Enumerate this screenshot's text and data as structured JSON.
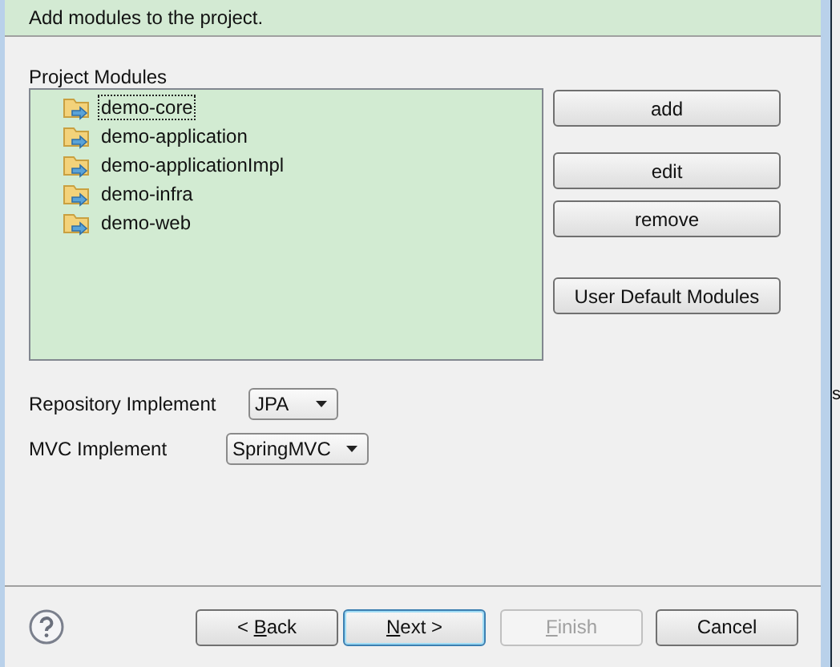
{
  "header": {
    "description": "Add modules to the project."
  },
  "modules": {
    "label": "Project Modules",
    "items": [
      {
        "name": "demo-core",
        "selected": true
      },
      {
        "name": "demo-application",
        "selected": false
      },
      {
        "name": "demo-applicationImpl",
        "selected": false
      },
      {
        "name": "demo-infra",
        "selected": false
      },
      {
        "name": "demo-web",
        "selected": false
      }
    ]
  },
  "module_buttons": [
    "add",
    "edit",
    "remove",
    "User Default Modules"
  ],
  "settings": [
    {
      "label": "Repository Implement",
      "value": "JPA"
    },
    {
      "label": "MVC Implement",
      "value": "SpringMVC"
    }
  ],
  "footer_buttons": [
    {
      "pre": "< ",
      "key": "B",
      "post": "ack",
      "disabled": false,
      "default": false
    },
    {
      "key": "N",
      "post": "ext >",
      "disabled": false,
      "default": true
    },
    {
      "key": "F",
      "post": "inish",
      "disabled": true,
      "default": false
    },
    {
      "pre": "Cancel",
      "disabled": false,
      "default": false
    }
  ],
  "background_window": {
    "text": "s"
  }
}
